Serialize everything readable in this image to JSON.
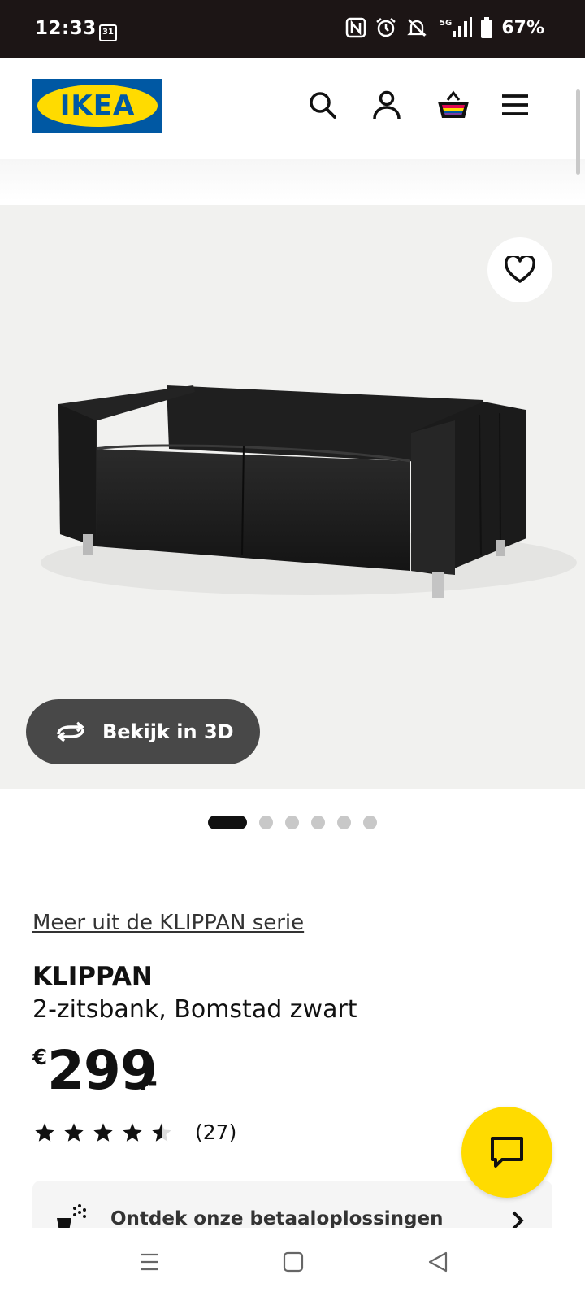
{
  "status_bar": {
    "time": "12:33",
    "calendar_day": "31",
    "battery": "67%",
    "icons": [
      "nfc-icon",
      "alarm-icon",
      "mute-icon",
      "5g-signal-icon",
      "battery-icon"
    ]
  },
  "header": {
    "logo_text": "IKEA",
    "icons": [
      "search-icon",
      "account-icon",
      "basket-icon",
      "menu-icon"
    ]
  },
  "gallery": {
    "view_3d_label": "Bekijk in 3D",
    "total_images": 6,
    "active_index": 0
  },
  "product": {
    "series_link": "Meer uit de KLIPPAN serie",
    "name": "KLIPPAN",
    "description": "2-zitsbank, Bomstad zwart",
    "currency": "€",
    "price": "299",
    "price_suffix": ".-",
    "rating": 4.5,
    "rating_count": "(27)"
  },
  "payment_banner": {
    "label": "Ontdek onze betaaloplossingen"
  },
  "colors": {
    "ikea_blue": "#0058a3",
    "ikea_yellow": "#ffdb00",
    "status_bar_bg": "#1c1515"
  }
}
